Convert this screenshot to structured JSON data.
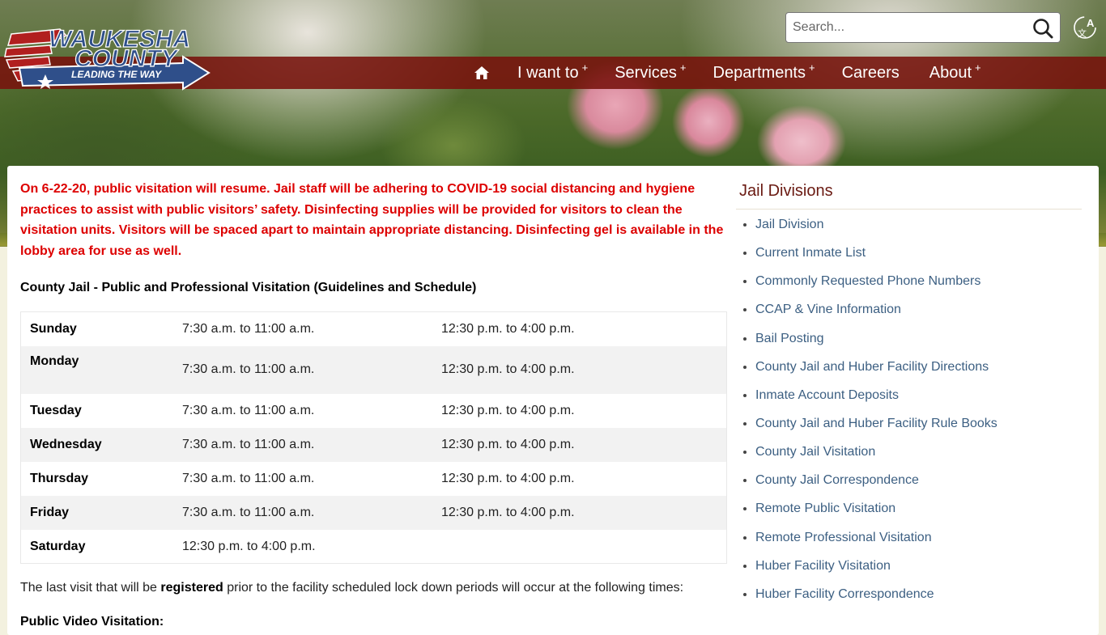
{
  "header": {
    "logo": {
      "line1": "WAUKESHA",
      "line2": "COUNTY",
      "tagline": "LEADING THE WAY"
    },
    "search": {
      "placeholder": "Search...",
      "value": ""
    },
    "nav": [
      {
        "label": "I want to",
        "has_submenu": true,
        "marker": "+"
      },
      {
        "label": "Services",
        "has_submenu": true,
        "marker": "+"
      },
      {
        "label": "Departments",
        "has_submenu": true,
        "marker": "+"
      },
      {
        "label": "Careers",
        "has_submenu": false,
        "marker": ""
      },
      {
        "label": "About",
        "has_submenu": true,
        "marker": "+"
      }
    ],
    "colors": {
      "navbar": "#7a120c",
      "accent_red": "#dd0000",
      "link": "#3c5f82",
      "sidebar_title": "#6a1a12"
    }
  },
  "main": {
    "notice": "On 6-22-20, public visitation will resume.  Jail staff will be adhering to COVID-19 social distancing and hygiene practices to assist with public visitors’ safety.  Disinfecting supplies will be provided for visitors to clean the visitation units. Visitors will be spaced apart to maintain appropriate distancing. Disinfecting gel is available in the lobby area for use as well.",
    "schedule_title": "County Jail - Public and Professional Visitation (Guidelines and Schedule)",
    "schedule": [
      {
        "day": "Sunday",
        "morning": "7:30 a.m. to 11:00 a.m.",
        "afternoon": "12:30 p.m. to 4:00 p.m."
      },
      {
        "day": "Monday",
        "morning": "7:30 a.m. to 11:00 a.m.",
        "afternoon": "12:30 p.m. to 4:00 p.m."
      },
      {
        "day": "Tuesday",
        "morning": "7:30 a.m. to 11:00 a.m.",
        "afternoon": "12:30 p.m. to 4:00 p.m."
      },
      {
        "day": "Wednesday",
        "morning": "7:30 a.m. to 11:00 a.m.",
        "afternoon": "12:30 p.m. to 4:00 p.m."
      },
      {
        "day": "Thursday",
        "morning": "7:30 a.m. to 11:00 a.m.",
        "afternoon": "12:30 p.m. to 4:00 p.m."
      },
      {
        "day": "Friday",
        "morning": "7:30 a.m. to 11:00 a.m.",
        "afternoon": "12:30 p.m. to 4:00 p.m."
      },
      {
        "day": "Saturday",
        "morning": "12:30 p.m. to 4:00 p.m.",
        "afternoon": ""
      }
    ],
    "last_visit": {
      "before": "The last visit that will be ",
      "bold": "registered",
      "after": " prior to the facility scheduled lock down periods will occur at the following times:"
    },
    "video_heading": "Public Video Visitation:"
  },
  "sidebar": {
    "title": "Jail Divisions",
    "links": [
      "Jail Division",
      "Current Inmate List",
      "Commonly Requested Phone Numbers",
      "CCAP & Vine Information",
      "Bail Posting",
      "County Jail and Huber Facility Directions",
      "Inmate Account Deposits",
      "County Jail and Huber Facility Rule Books",
      "County Jail Visitation",
      "County Jail Correspondence",
      "Remote Public Visitation",
      "Remote Professional Visitation",
      "Huber Facility Visitation",
      "Huber Facility Correspondence"
    ]
  },
  "icons": {
    "home": "home-icon",
    "search": "search-icon",
    "translate": "translate-icon"
  }
}
